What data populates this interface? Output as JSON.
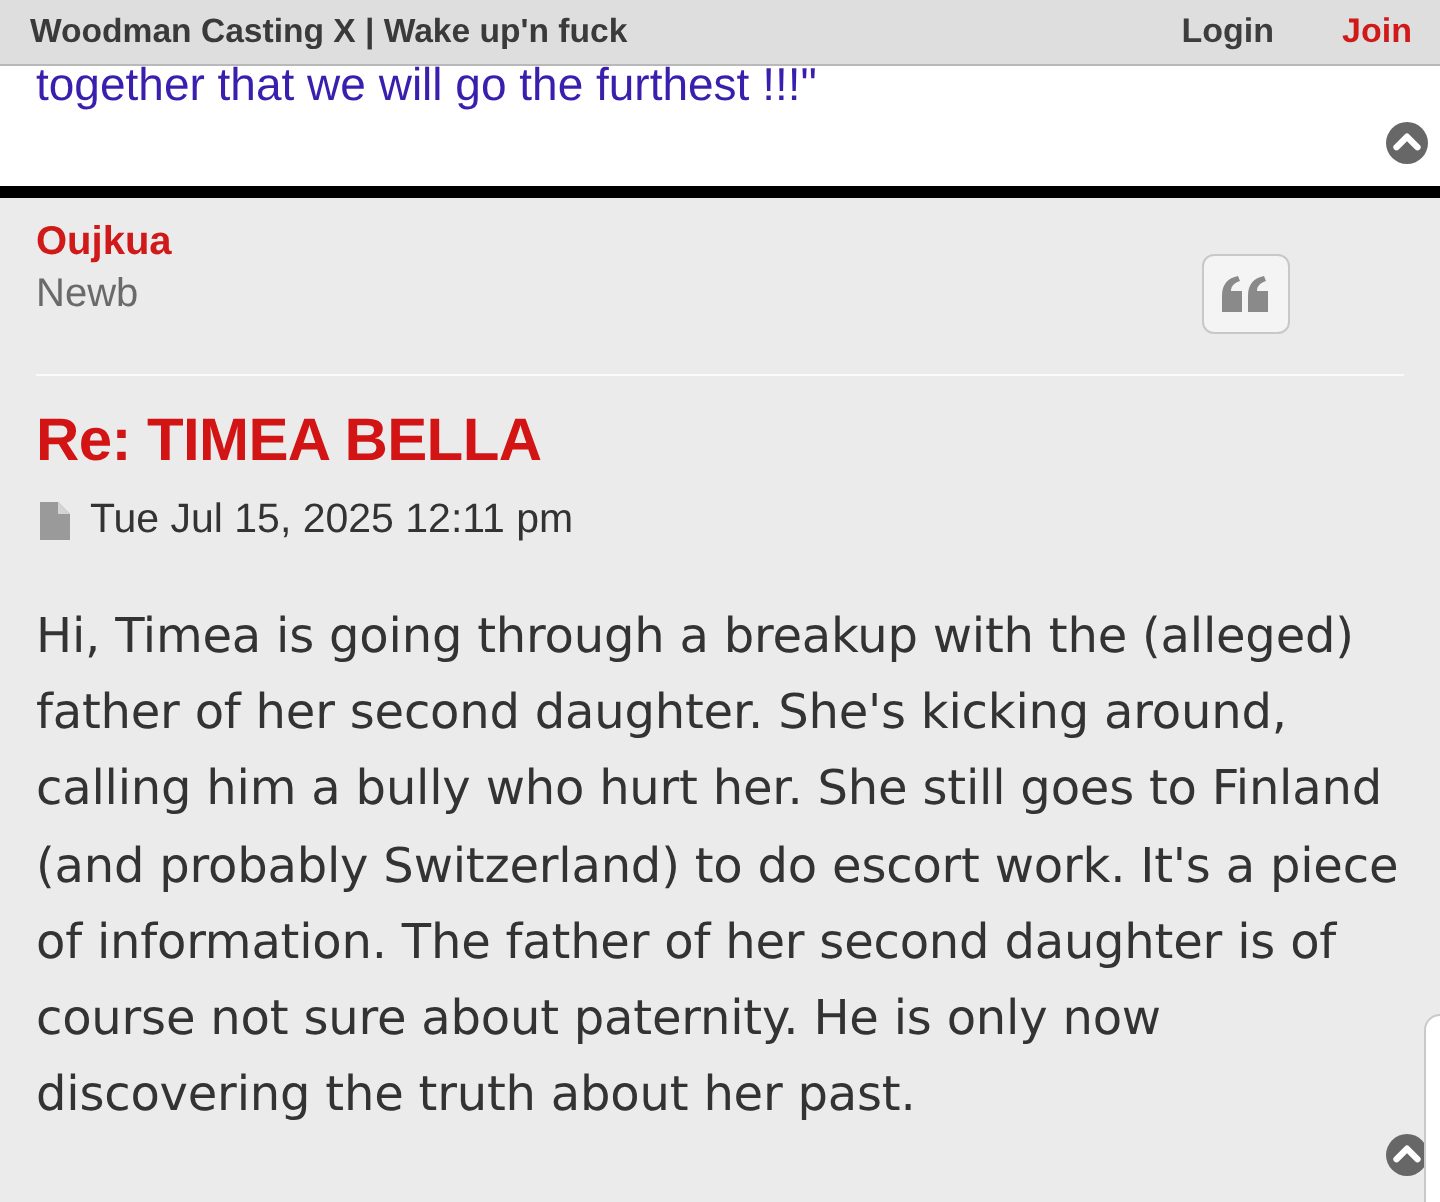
{
  "top_bar": {
    "title": "Woodman Casting X | Wake up'n fuck",
    "links": [
      {
        "label": "Login",
        "kind": "plain"
      },
      {
        "label": "Join",
        "kind": "highlight"
      }
    ]
  },
  "previous_post": {
    "text": "together that we will go the furthest !!!\""
  },
  "post": {
    "author": "Oujkua",
    "rank": "Newb",
    "title": "Re: TIMEA BELLA",
    "date": "Tue Jul 15, 2025 12:11 pm",
    "body": "Hi, Timea is going through a breakup with the (alleged) father of her second daughter. She's kicking around,\ncalling him a bully who hurt her. She still goes to Finland (and probably Switzerland) to do escort work. It's a piece of information. The father of her second daughter is of course not sure about paternity. He is only now discovering the truth about her past."
  }
}
